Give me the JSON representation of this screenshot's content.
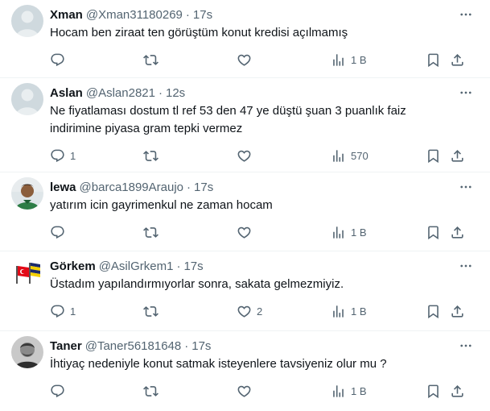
{
  "tweets": [
    {
      "name": "Xman",
      "handle": "@Xman31180269",
      "time": "17s",
      "text": "Hocam ben ziraat ten görüştüm konut kredisi açılmamış",
      "replies": "",
      "retweets": "",
      "likes": "",
      "views": "1 B",
      "avatar": "default"
    },
    {
      "name": "Aslan",
      "handle": "@Aslan2821",
      "time": "12s",
      "text": "Ne fiyatlaması dostum tl ref 53 den 47 ye düştü şuan 3 puanlık faiz indirimine piyasa gram tepki vermez",
      "replies": "1",
      "retweets": "",
      "likes": "",
      "views": "570",
      "avatar": "default"
    },
    {
      "name": "lewa",
      "handle": "@barca1899Araujo",
      "time": "17s",
      "text": "yatırım icin gayrimenkul ne zaman hocam",
      "replies": "",
      "retweets": "",
      "likes": "",
      "views": "1 B",
      "avatar": "photo-person"
    },
    {
      "name": "Görkem",
      "handle": "@AsilGrkem1",
      "time": "17s",
      "text": "Üstadım yapılandırmıyorlar sonra, sakata gelmezmiyiz.",
      "replies": "1",
      "retweets": "",
      "likes": "2",
      "views": "1 B",
      "avatar": "flags"
    },
    {
      "name": "Taner",
      "handle": "@Taner56181648",
      "time": "17s",
      "text": "İhtiyaç nedeniyle konut satmak isteyenlere tavsiyeniz olur mu ?",
      "replies": "",
      "retweets": "",
      "likes": "",
      "views": "1 B",
      "avatar": "photo-bw"
    }
  ],
  "icons": {
    "more": "more-dots-icon",
    "reply": "reply-icon",
    "retweet": "retweet-icon",
    "like": "like-heart-icon",
    "views": "views-chart-icon",
    "bookmark": "bookmark-icon",
    "share": "share-icon"
  },
  "colors": {
    "text": "#0f1419",
    "secondary": "#536471",
    "divider": "#eff3f4"
  }
}
